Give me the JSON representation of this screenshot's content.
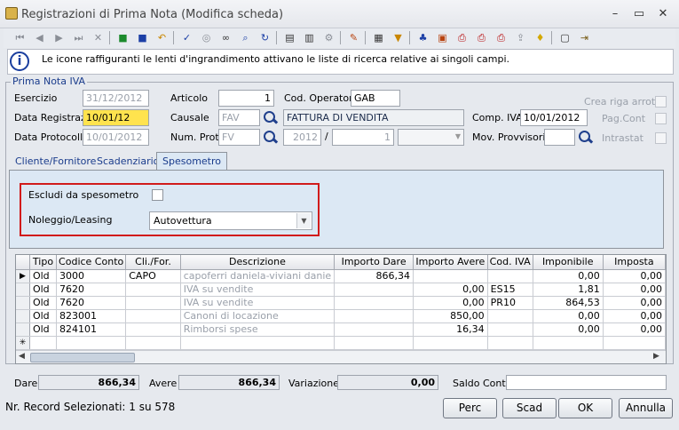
{
  "window": {
    "title": "Registrazioni di Prima Nota (Modifica scheda)",
    "controls": [
      "–",
      "▭",
      "✕"
    ]
  },
  "toolbar": {
    "icons": [
      "first-record-icon",
      "prev-record-icon",
      "next-record-icon",
      "last-record-icon",
      "delete-icon",
      "save-icon",
      "save-as-icon",
      "undo-icon",
      "spellcheck-icon",
      "globe-icon",
      "binoculars-icon",
      "zoom-icon",
      "refresh-search-icon",
      "document-icon",
      "document-list-icon",
      "settings-icon",
      "edit-icon",
      "table-icon",
      "filter-icon",
      "users-icon",
      "calendar-icon",
      "print-icon",
      "print-preview-icon",
      "print-multi-icon",
      "export-icon",
      "idea-icon",
      "window-icon",
      "exit-icon"
    ]
  },
  "info": {
    "text": "Le icone raffiguranti le lenti d'ingrandimento attivano le liste di ricerca relative ai singoli campi."
  },
  "iva": {
    "legend": "Prima Nota IVA",
    "esercizio_label": "Esercizio",
    "esercizio": "31/12/2012",
    "data_reg_label": "Data Registraz.",
    "data_reg": "10/01/12",
    "data_prot_label": "Data Protocollo",
    "data_prot": "10/01/2012",
    "articolo_label": "Articolo",
    "articolo": "1",
    "causale_label": "Causale",
    "causale": "FAV",
    "causale_desc": "FATTURA DI VENDITA",
    "num_prot_label": "Num. Prot.",
    "num_prot": "FV",
    "prot_year": "2012",
    "prot_slash": "/",
    "prot_num": "1",
    "cod_op_label": "Cod. Operatore",
    "cod_op": "GAB",
    "comp_iva_label": "Comp. IVA",
    "comp_iva": "10/01/2012",
    "mov_prov_label": "Mov. Provvisori",
    "mov_prov": "",
    "crea_riga_label": "Crea riga arrot.",
    "pag_cont_label": "Pag.Cont",
    "intrastat_label": "Intrastat"
  },
  "tabs": [
    {
      "label": "Cliente/Fornitore"
    },
    {
      "label": "Scadenziario"
    },
    {
      "label": "Spesometro"
    }
  ],
  "spesometro": {
    "escludi_label": "Escludi da spesometro",
    "escludi_checked": false,
    "noleggio_label": "Noleggio/Leasing",
    "noleggio_value": "Autovettura"
  },
  "grid": {
    "columns": [
      "Tipo",
      "Codice Conto",
      "Cli./For.",
      "Descrizione",
      "Importo Dare",
      "Importo Avere",
      "Cod. IVA",
      "Imponibile",
      "Imposta"
    ],
    "rows": [
      {
        "sel": "▶",
        "tipo": "Old",
        "conto": "3000",
        "clifor": "CAPO",
        "desc": "capoferri daniela-viviani danie",
        "dare": "866,34",
        "avere": "",
        "iva": "",
        "imponibile": "0,00",
        "imposta": "0,00"
      },
      {
        "sel": "",
        "tipo": "Old",
        "conto": "7620",
        "clifor": "",
        "desc": "IVA su vendite",
        "dare": "",
        "avere": "0,00",
        "iva": "ES15",
        "imponibile": "1,81",
        "imposta": "0,00"
      },
      {
        "sel": "",
        "tipo": "Old",
        "conto": "7620",
        "clifor": "",
        "desc": "IVA su vendite",
        "dare": "",
        "avere": "0,00",
        "iva": "PR10",
        "imponibile": "864,53",
        "imposta": "0,00"
      },
      {
        "sel": "",
        "tipo": "Old",
        "conto": "823001",
        "clifor": "",
        "desc": "Canoni di locazione",
        "dare": "",
        "avere": "850,00",
        "iva": "",
        "imponibile": "0,00",
        "imposta": "0,00"
      },
      {
        "sel": "",
        "tipo": "Old",
        "conto": "824101",
        "clifor": "",
        "desc": "Rimborsi spese",
        "dare": "",
        "avere": "16,34",
        "iva": "",
        "imponibile": "0,00",
        "imposta": "0,00"
      },
      {
        "sel": "✳",
        "tipo": "",
        "conto": "",
        "clifor": "",
        "desc": "",
        "dare": "",
        "avere": "",
        "iva": "",
        "imponibile": "",
        "imposta": ""
      }
    ]
  },
  "totals": {
    "dare_label": "Dare",
    "dare": "866,34",
    "avere_label": "Avere",
    "avere": "866,34",
    "variazione_label": "Variazione",
    "variazione": "0,00",
    "saldo_label": "Saldo Conto",
    "saldo": ""
  },
  "status": {
    "text": "Nr. Record Selezionati: 1 su 578"
  },
  "buttons": {
    "perc": "Perc",
    "scad": "Scad",
    "ok": "OK",
    "annulla": "Annulla"
  }
}
